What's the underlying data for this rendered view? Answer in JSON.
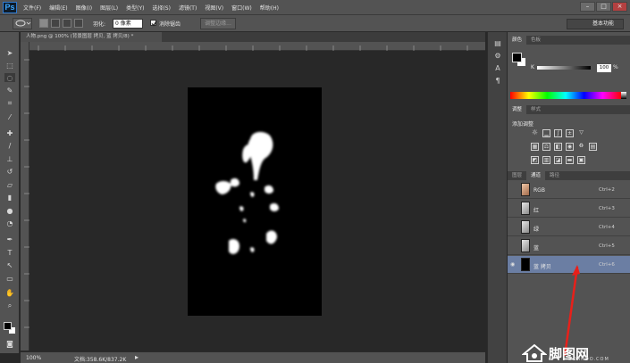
{
  "menubar": {
    "logo": "Ps",
    "items": [
      "文件(F)",
      "编辑(E)",
      "图像(I)",
      "图层(L)",
      "类型(Y)",
      "选择(S)",
      "滤镜(T)",
      "视图(V)",
      "窗口(W)",
      "帮助(H)"
    ]
  },
  "options": {
    "feather_label": "羽化:",
    "feather_value": "0 像素",
    "antialias_label": "消除锯齿",
    "refine_edge": "调整边缘...",
    "workspace": "基本功能"
  },
  "document": {
    "tab_title": "人物.png @ 100% (背景图层 拷贝, 蓝 拷贝/8) *"
  },
  "status": {
    "zoom": "100%",
    "doc_size": "文档:358.6K/837.2K"
  },
  "color_panel": {
    "tabs": [
      "颜色",
      "色板"
    ],
    "k_label": "K",
    "k_value": "100",
    "k_unit": "%"
  },
  "adjustments_panel": {
    "tabs": [
      "调整",
      "样式"
    ],
    "title": "添加调整"
  },
  "channels_panel": {
    "tabs": [
      "图层",
      "通道",
      "路径"
    ],
    "active_tab": "通道",
    "channels": [
      {
        "name": "RGB",
        "shortcut": "Ctrl+2"
      },
      {
        "name": "红",
        "shortcut": "Ctrl+3"
      },
      {
        "name": "绿",
        "shortcut": "Ctrl+4"
      },
      {
        "name": "蓝",
        "shortcut": "Ctrl+5"
      },
      {
        "name": "蓝 拷贝",
        "shortcut": "Ctrl+6"
      }
    ]
  },
  "watermark": {
    "text": "脚图网",
    "sub": "DOANDO.COM"
  }
}
